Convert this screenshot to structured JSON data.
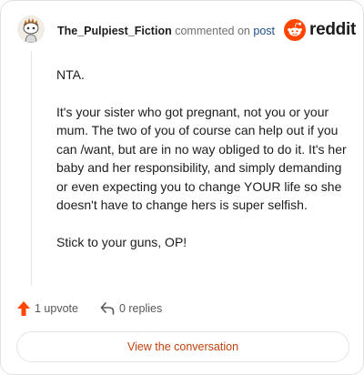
{
  "comment": {
    "username": "The_Pulpiest_Fiction",
    "action_text": "commented on",
    "post_link": "post",
    "paragraphs": [
      "NTA.",
      "It's your sister who got pregnant, not you or your mum. The two of you of course can help out if you can /want, but are in no way obliged to do it. It's her baby and her responsibility, and simply demanding or even expecting you to change YOUR life so she doesn't have to change hers is super selfish.",
      "Stick to your guns, OP!"
    ]
  },
  "brand": {
    "name": "reddit",
    "color": "#ff4500"
  },
  "actions": {
    "upvote_label": "1 upvote",
    "replies_label": "0 replies"
  },
  "cta": {
    "label": "View the conversation"
  },
  "colors": {
    "upvote_arrow": "#ff4500",
    "cta_text": "#c2410c",
    "link": "#1c4e8a"
  }
}
